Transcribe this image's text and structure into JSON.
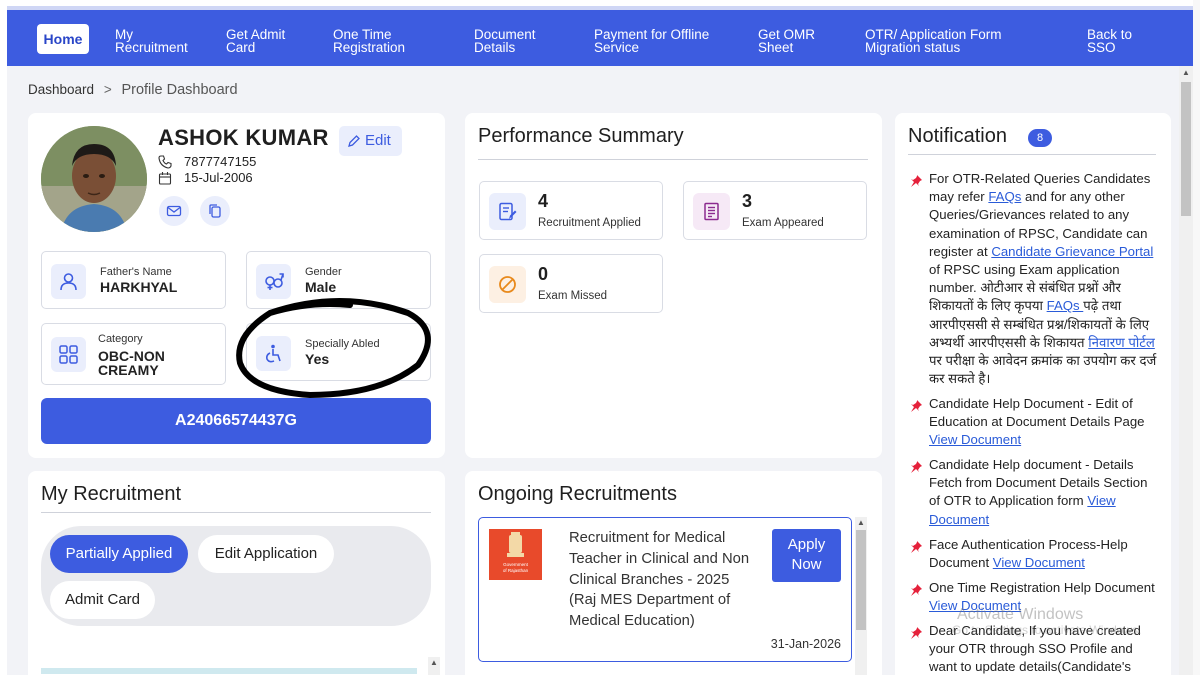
{
  "nav": {
    "home": "Home",
    "items": [
      {
        "l1": "My",
        "l2": "Recruitment"
      },
      {
        "l1": "Get Admit",
        "l2": "Card"
      },
      {
        "l1": "One Time",
        "l2": "Registration"
      },
      {
        "l1": "Document",
        "l2": "Details"
      },
      {
        "l1": "Payment for Offline",
        "l2": "Service"
      },
      {
        "l1": "Get OMR",
        "l2": "Sheet"
      },
      {
        "l1": "OTR/ Application Form",
        "l2": "Migration status"
      },
      {
        "l1": "Back to",
        "l2": "SSO"
      }
    ]
  },
  "breadcrumb": {
    "root": "Dashboard",
    "sep": ">",
    "current": "Profile Dashboard"
  },
  "profile": {
    "name": "ASHOK KUMAR",
    "edit_label": "Edit",
    "phone": "7877747155",
    "dob": "15-Jul-2006",
    "father_label": "Father's Name",
    "father_value": "HARKHYAL",
    "gender_label": "Gender",
    "gender_value": "Male",
    "category_label": "Category",
    "category_value": "OBC-NON CREAMY",
    "specially_label": "Specially Abled",
    "specially_value": "Yes",
    "otr_id": "A24066574437G"
  },
  "performance": {
    "title": "Performance Summary",
    "stats": [
      {
        "value": "4",
        "label": "Recruitment Applied"
      },
      {
        "value": "3",
        "label": "Exam Appeared"
      },
      {
        "value": "0",
        "label": "Exam Missed"
      }
    ]
  },
  "notification": {
    "title": "Notification",
    "count": "8",
    "items": [
      {
        "t1": "For OTR-Related Queries Candidates may refer ",
        "l1": "FAQs",
        "t2": " and for any other Queries/Grievances related to any examination of RPSC, Candidate can register at ",
        "l2": "Candidate Grievance Portal ",
        "t3": "of RPSC using Exam application number. ओटीआर से संबंधित प्रश्नों और शिकायतों के लिए कृपया ",
        "l3": "FAQs ",
        "t4": "पढ़े तथा आरपीएससी से सम्बंधित प्रश्न/शिकायतों के लिए अभ्यर्थी आरपीएससी के शिकायत ",
        "l4": "निवारण पोर्टल ",
        "t5": "पर परीक्षा के आवेदन क्रमांक का उपयोग कर दर्ज कर सकते है।"
      },
      {
        "t1": "Candidate Help Document - Edit of Education at Document Details Page ",
        "l1": "View Document"
      },
      {
        "t1": "Candidate Help document - Details Fetch from Document Details Section of OTR to Application form ",
        "l1": "View Document"
      },
      {
        "t1": "Face Authentication Process-Help Document ",
        "l1": "View Document"
      },
      {
        "t1": "One Time Registration Help Document ",
        "l1": "View Document"
      },
      {
        "t1": "Dear Candidate, If you have created your OTR through SSO Profile and want to update details(Candidate's"
      }
    ]
  },
  "my_recruitment": {
    "title": "My Recruitment",
    "pills": [
      "Partially Applied",
      "Edit Application",
      "Admit Card"
    ]
  },
  "ongoing": {
    "title": "Ongoing Recruitments",
    "card": {
      "text": "Recruitment for Medical Teacher in Clinical and Non Clinical Branches - 2025 (Raj MES Department of Medical Education)",
      "apply": "Apply Now",
      "date": "31-Jan-2026",
      "logo_text": "Government of Rajasthan"
    }
  },
  "watermark": {
    "line1": "Activate Windows",
    "line2": "Go to Settings to activate Windows."
  },
  "colors": {
    "primary": "#3d5ce0",
    "background": "#f2f3f7",
    "pin": "#e5213b"
  }
}
